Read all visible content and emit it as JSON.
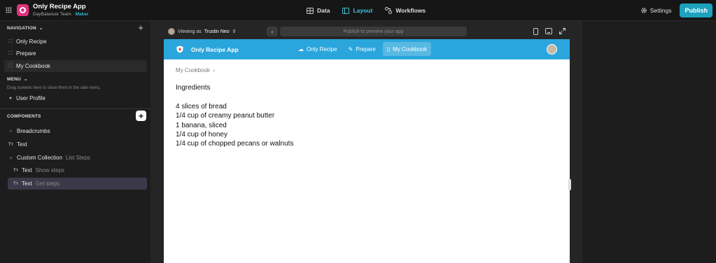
{
  "topbar": {
    "app_name": "Only Recipe App",
    "team": "DayBalancer Team",
    "role": "Maker",
    "tabs": [
      {
        "label": "Data",
        "icon": "table-icon"
      },
      {
        "label": "Layout",
        "icon": "layout-icon"
      },
      {
        "label": "Workflows",
        "icon": "workflow-icon"
      }
    ],
    "active_tab": "Layout",
    "settings_label": "Settings",
    "publish_label": "Publish"
  },
  "sidebar": {
    "navigation_title": "NAVIGATION",
    "navigation_items": [
      "Only Recipe",
      "Prepare",
      "My Cookbook"
    ],
    "selected_navigation": "My Cookbook",
    "menu_title": "MENU",
    "menu_hint": "Drag screens here to show them in the side menu.",
    "menu_items": [
      "User Profile"
    ],
    "components_title": "COMPONENTS",
    "components": [
      {
        "icon": "chevron-right-icon",
        "label": "Breadcrumbs",
        "sub": ""
      },
      {
        "icon": "text-icon",
        "label": "Text",
        "sub": ""
      },
      {
        "icon": "collection-icon",
        "label": "Custom Collection",
        "sub": "List Steps"
      },
      {
        "icon": "text-icon",
        "label": "Text",
        "sub": "Show steps"
      },
      {
        "icon": "text-icon",
        "label": "Text",
        "sub": "Get steps"
      }
    ]
  },
  "preview": {
    "viewing_prefix": "Viewing as",
    "viewing_user": "Trustin Neo",
    "url_placeholder": "Publish to preview your app"
  },
  "app": {
    "title": "Only Recipe App",
    "nav": [
      "Only Recipe",
      "Prepare",
      "My Cookbook"
    ],
    "active_nav": "My Cookbook",
    "breadcrumb": "My Cookbook",
    "ingredients_title": "Ingredients",
    "ingredients": [
      "4 slices of bread",
      "1/4 cup of creamy peanut butter",
      "1 banana, sliced",
      "1/4 cup of honey",
      "1/4 cup of chopped pecans or walnuts"
    ]
  },
  "colors": {
    "accent": "#2aa6dc",
    "publish": "#1da1bd",
    "logo": "#e0307a"
  }
}
